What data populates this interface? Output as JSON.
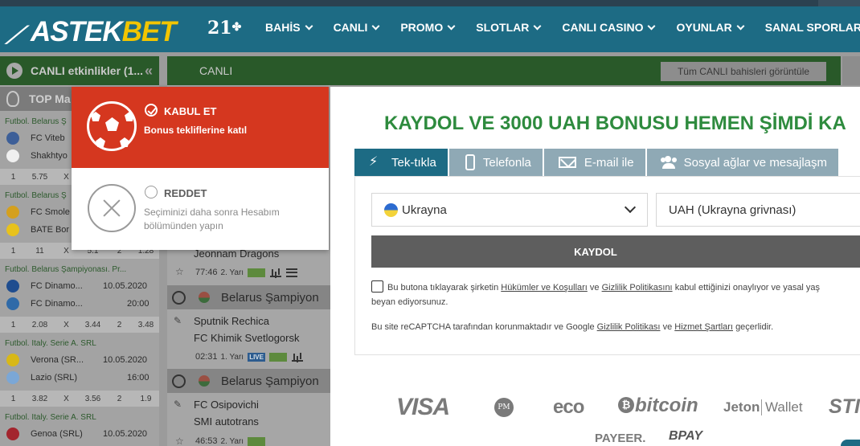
{
  "header": {
    "brand_part1": "ASTEK",
    "brand_part2": "BET",
    "age_badge": "21",
    "nav": [
      {
        "label": "BAHİS"
      },
      {
        "label": "CANLI"
      },
      {
        "label": "PROMO"
      },
      {
        "label": "SLOTLAR"
      },
      {
        "label": "CANLI CASINO"
      },
      {
        "label": "OYUNLAR"
      },
      {
        "label": "SANAL SPORLAR"
      }
    ]
  },
  "live_sidebar": {
    "title": "CANLI etkinlikler (1...",
    "collapse_icon": "double-chevron-left-icon",
    "top_label": "TOP Ma",
    "leagues": [
      {
        "name": "Futbol. Belarus Ş",
        "teams": [
          "FC Viteb",
          "Shakhtyo"
        ],
        "odds": [
          "1",
          "5.75",
          "X",
          "",
          "2",
          ""
        ]
      },
      {
        "name": "Futbol. Belarus Ş",
        "teams": [
          "FC Smole",
          "BATE Bor"
        ],
        "odds": [
          "1",
          "11",
          "X",
          "5.1",
          "2",
          "1.28"
        ]
      },
      {
        "name": "Futbol. Belarus Şampiyonası. Pr...",
        "teams": [
          "FC Dinamo...",
          "FC Dinamo..."
        ],
        "date": "10.05.2020",
        "time": "20:00",
        "odds": [
          "1",
          "2.08",
          "X",
          "3.44",
          "2",
          "3.48"
        ]
      },
      {
        "name": "Futbol. Italy. Serie A. SRL",
        "teams": [
          "Verona (SR...",
          "Lazio (SRL)"
        ],
        "date": "10.05.2020",
        "time": "16:00",
        "odds": [
          "1",
          "3.82",
          "X",
          "3.56",
          "2",
          "1.9"
        ]
      },
      {
        "name": "Futbol. Italy. Serie A. SRL",
        "teams": [
          "Genoa (SRL)"
        ],
        "date": "10.05.2020"
      }
    ]
  },
  "live_main": {
    "title": "CANLI",
    "view_all": "Tüm CANLI bahisleri görüntüle",
    "events": [
      {
        "team": "Jeonnam Dragons",
        "clock": "77:46",
        "half": "2. Yarı"
      },
      {
        "league": "Belarus Şampiyon",
        "teams": [
          "Sputnik Rechica",
          "FC Khimik Svetlogorsk"
        ],
        "clock": "02:31",
        "half": "1. Yarı",
        "live_badge": "LIVE"
      },
      {
        "league": "Belarus Şampiyon",
        "teams": [
          "FC Osipovichi",
          "SMI autotrans"
        ],
        "clock": "46:53",
        "half": "2. Yarı"
      }
    ]
  },
  "consent": {
    "accept_title": "KABUL ET",
    "accept_sub": "Bonus tekliflerine katıl",
    "reject_title": "REDDET",
    "reject_sub": "Seçiminizi daha sonra Hesabım bölümünden yapın"
  },
  "register": {
    "title": "KAYDOL VE 3000 UAH BONUSU HEMEN ŞİMDİ KA",
    "tabs": [
      {
        "label": "Tek-tıkla",
        "icon": "bolt-icon",
        "active": true
      },
      {
        "label": "Telefonla",
        "icon": "phone-icon"
      },
      {
        "label": "E-mail ile",
        "icon": "mail-icon"
      },
      {
        "label": "Sosyal ağlar ve mesajlaşm",
        "icon": "users-icon"
      }
    ],
    "country": "Ukrayna",
    "currency": "UAH (Ukrayna grivnası)",
    "submit": "KAYDOL",
    "terms": {
      "t1": "Bu butona tıklayarak şirketin",
      "link1": "Hükümler ve Koşulları",
      "t2": "ve",
      "link2": "Gizlilik Politikasını",
      "t3": "kabul ettiğinizi onaylıyor ve yasal yaş",
      "t4": "beyan ediyorsunuz."
    },
    "captcha": {
      "t1": "Bu site reCAPTCHA tarafından korunmaktadır ve Google",
      "link1": "Gizlilik Politikası",
      "t2": "ve",
      "link2": "Hizmet Şartları",
      "t3": "geçerlidir."
    }
  },
  "payments": {
    "visa": "VISA",
    "pm": "PM",
    "eco": "eco",
    "bitcoin": "bitcoin",
    "jeton": "Jeton",
    "wallet": "Wallet",
    "sticpay": "STIC",
    "payeer": "PAYEER.",
    "bpay": "BPAY"
  }
}
